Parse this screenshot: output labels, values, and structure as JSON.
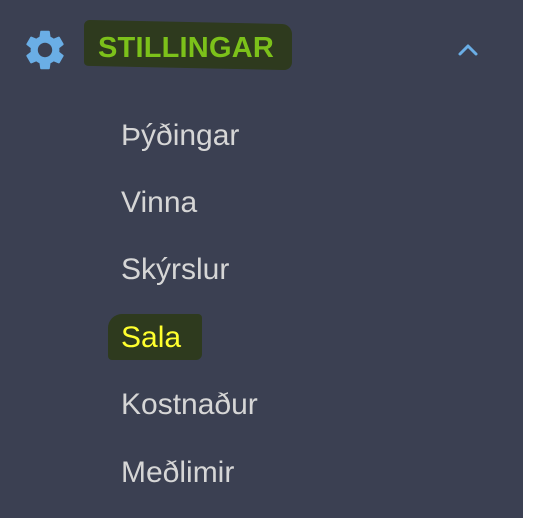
{
  "sidebar": {
    "section": {
      "icon": "gear-icon",
      "label": "STILLINGAR",
      "expanded": true,
      "chevron_icon": "chevron-up-icon"
    },
    "items": [
      {
        "label": "Þýðingar",
        "active": false
      },
      {
        "label": "Vinna",
        "active": false
      },
      {
        "label": "Skýrslur",
        "active": false
      },
      {
        "label": "Sala",
        "active": true
      },
      {
        "label": "Kostnaður",
        "active": false
      },
      {
        "label": "Meðlimir",
        "active": false
      }
    ]
  },
  "colors": {
    "background": "#3b4052",
    "header_text": "#7cc11a",
    "item_text": "#d6d6d6",
    "active_item_text": "#ffff2e",
    "highlight_marker": "#2e3a1e",
    "icon_blue": "#6aaee6"
  }
}
